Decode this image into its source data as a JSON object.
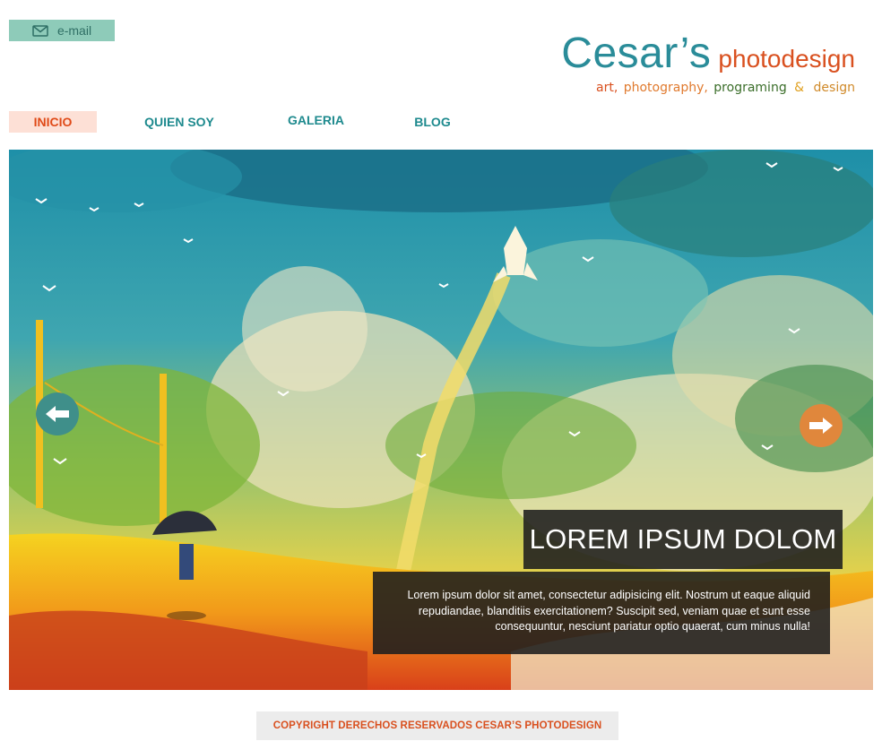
{
  "header": {
    "email_label": "e-mail",
    "logo_name": "Cesar’s",
    "logo_suffix": "photodesign",
    "tagline": [
      {
        "text": "art,",
        "color": "#d9501f"
      },
      {
        "text": "photography,",
        "color": "#e07a2e"
      },
      {
        "text": "programing",
        "color": "#3b6e2a"
      },
      {
        "text": "&",
        "color": "#e0a020"
      },
      {
        "text": "design",
        "color": "#d08a2a"
      }
    ],
    "colors": {
      "brand_teal": "#2a8c99",
      "brand_orange": "#d9501f",
      "email_bg": "#8ecbb9"
    }
  },
  "nav": {
    "items": [
      {
        "label": "INICIO",
        "active": true
      },
      {
        "label": "QUIEN SOY",
        "active": false
      },
      {
        "label": "GALERIA",
        "active": false
      },
      {
        "label": "BLOG",
        "active": false
      }
    ]
  },
  "slider": {
    "icons": {
      "prev": "arrow-left-icon",
      "next": "arrow-right-icon"
    },
    "caption_title": "LOREM IPSUM DOLOM",
    "caption_text": "Lorem ipsum dolor sit amet, consectetur adipisicing elit. Nostrum ut eaque aliquid repudiandae, blanditiis exercitationem? Suscipit sed, veniam quae et sunt esse consequuntur, nesciunt pariatur optio quaerat, cum minus nulla!"
  },
  "footer": {
    "copyright": "COPYRIGHT DERECHOS RESERVADOS  CESAR’S PHOTODESIGN"
  }
}
